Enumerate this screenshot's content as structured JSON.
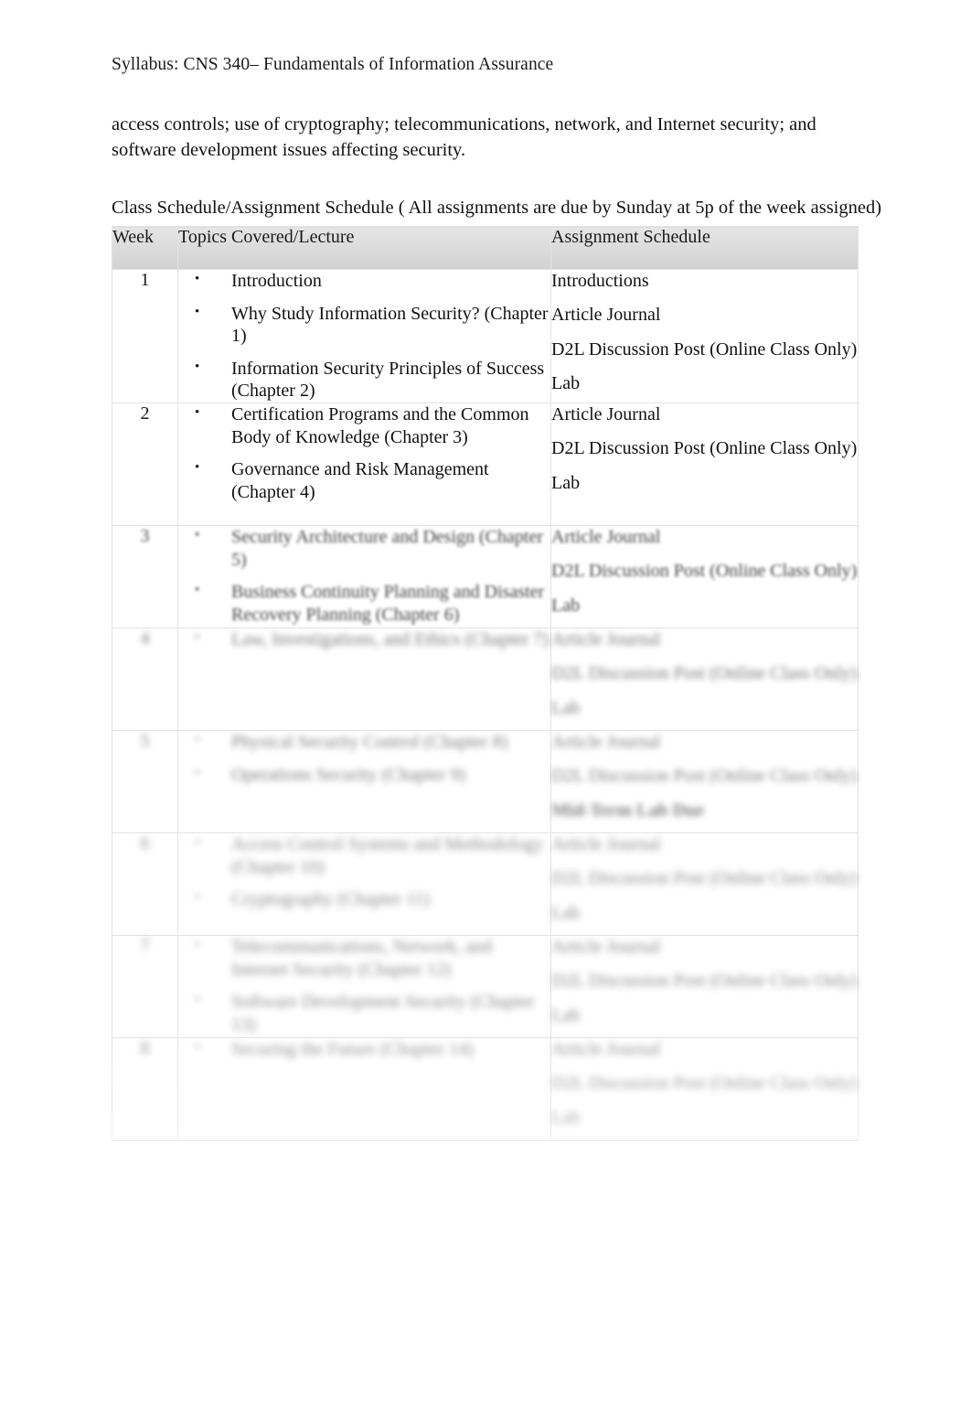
{
  "document": {
    "running_header": "Syllabus:  CNS 340– Fundamentals of Information Assurance",
    "body_paragraph": "access controls; use of cryptography; telecommunications, network, and Internet security; and software development issues affecting security.",
    "schedule_caption": "Class Schedule/Assignment Schedule ( All assignments are due by Sunday at 5p of the week assigned)"
  },
  "table": {
    "columns": {
      "week": "Week",
      "topics": "Topics Covered/Lecture",
      "assignments": "Assignment Schedule"
    },
    "rows": [
      {
        "week": "1",
        "topics": [
          "Introduction",
          "Why Study Information Security? (Chapter 1)",
          "Information Security Principles of Success (Chapter 2)"
        ],
        "assignments": [
          {
            "text": "Introductions",
            "bold": false
          },
          {
            "text": "Article Journal",
            "bold": false
          },
          {
            "text": "D2L Discussion Post (Online Class Only)",
            "bold": false
          },
          {
            "text": "Lab",
            "bold": false
          }
        ]
      },
      {
        "week": "2",
        "topics": [
          "Certification Programs and the Common Body of Knowledge (Chapter 3)",
          "Governance and Risk Management (Chapter 4)"
        ],
        "assignments": [
          {
            "text": "Article Journal",
            "bold": false
          },
          {
            "text": "D2L Discussion Post (Online Class Only)",
            "bold": false
          },
          {
            "text": "Lab",
            "bold": false
          }
        ]
      },
      {
        "week": "3",
        "topics": [
          "Security Architecture and Design (Chapter 5)",
          "Business Continuity Planning and Disaster Recovery Planning (Chapter 6)"
        ],
        "assignments": [
          {
            "text": "Article Journal",
            "bold": false
          },
          {
            "text": "D2L Discussion Post (Online Class Only)",
            "bold": false
          },
          {
            "text": "Lab",
            "bold": false
          }
        ]
      },
      {
        "week": "4",
        "topics": [
          "Law, Investigations, and Ethics (Chapter 7)"
        ],
        "assignments": [
          {
            "text": "Article Journal",
            "bold": false
          },
          {
            "text": "D2L Discussion Post (Online Class Only)",
            "bold": false
          },
          {
            "text": "Lab",
            "bold": false
          }
        ]
      },
      {
        "week": "5",
        "topics": [
          "Physical Security Control (Chapter 8)",
          "Operations Security (Chapter 9)"
        ],
        "assignments": [
          {
            "text": "Article Journal",
            "bold": false
          },
          {
            "text": "D2L Discussion Post (Online Class Only)",
            "bold": false
          },
          {
            "text": "Mid-Term Lab Due",
            "bold": true
          }
        ]
      },
      {
        "week": "6",
        "topics": [
          "Access Control Systems and Methodology (Chapter 10)",
          "Cryptography (Chapter 11)"
        ],
        "assignments": [
          {
            "text": "Article Journal",
            "bold": false
          },
          {
            "text": "D2L Discussion Post (Online Class Only)",
            "bold": false
          },
          {
            "text": "Lab",
            "bold": false
          }
        ]
      },
      {
        "week": "7",
        "topics": [
          "Telecommunications, Network, and Internet Security (Chapter 12)",
          "Software Development Security (Chapter 13)"
        ],
        "assignments": [
          {
            "text": "Article Journal",
            "bold": false
          },
          {
            "text": "D2L Discussion Post (Online Class Only)",
            "bold": false
          },
          {
            "text": "Lab",
            "bold": false
          }
        ]
      },
      {
        "week": "8",
        "topics": [
          "Securing the Future (Chapter 14)"
        ],
        "assignments": [
          {
            "text": "Article Journal",
            "bold": false
          },
          {
            "text": "D2L Discussion Post (Online Class Only)",
            "bold": false
          },
          {
            "text": "Lab",
            "bold": false
          }
        ]
      }
    ]
  },
  "style": {
    "header_background": "#dcdcdc",
    "border_color": "#e3e3e3",
    "text_color": "#111111",
    "page_background": "#ffffff"
  }
}
